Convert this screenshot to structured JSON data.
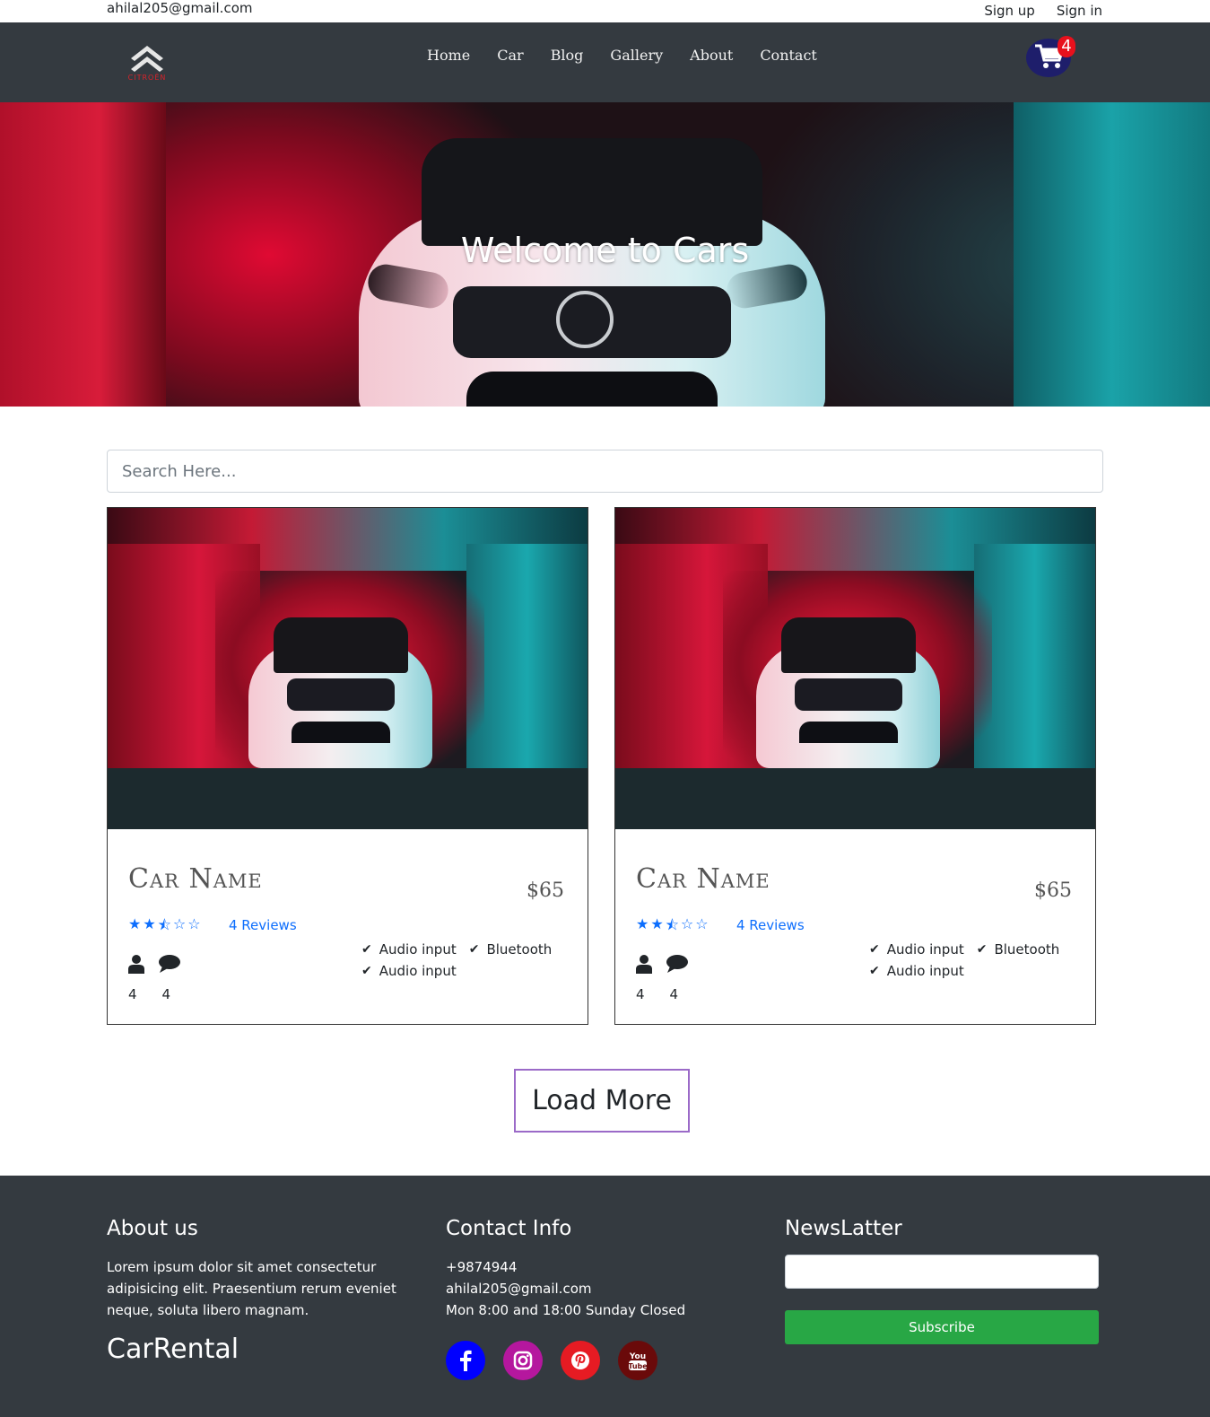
{
  "topbar": {
    "email": "ahilal205@gmail.com",
    "signup": "Sign up",
    "signin": "Sign in"
  },
  "brand": {
    "logo_text": "CITROËN"
  },
  "nav": {
    "items": [
      "Home",
      "Car",
      "Blog",
      "Gallery",
      "About",
      "Contact"
    ]
  },
  "cart": {
    "count": "4",
    "icon": "shopping-cart-icon"
  },
  "hero": {
    "title": "Welcome to Cars"
  },
  "search": {
    "placeholder": "Search Here..."
  },
  "cards": [
    {
      "name": "Car Name",
      "price": "$65",
      "rating": 2.5,
      "rating_max": 5,
      "reviews": "4 Reviews",
      "user_count": "4",
      "comment_count": "4",
      "features": [
        "Audio input",
        "Bluetooth",
        "Audio input"
      ]
    },
    {
      "name": "Car Name",
      "price": "$65",
      "rating": 2.5,
      "rating_max": 5,
      "reviews": "4 Reviews",
      "user_count": "4",
      "comment_count": "4",
      "features": [
        "Audio input",
        "Bluetooth",
        "Audio input"
      ]
    }
  ],
  "load_more": "Load More",
  "footer": {
    "about": {
      "heading": "About us",
      "text": "Lorem ipsum dolor sit amet consectetur adipisicing elit. Praesentium rerum eveniet neque, soluta libero magnam.",
      "brand": "CarRental"
    },
    "contact": {
      "heading": "Contact Info",
      "phone": "+9874944",
      "email": "ahilal205@gmail.com",
      "hours": "Mon 8:00 and 18:00 Sunday Closed",
      "social": [
        {
          "name": "facebook-icon",
          "color": "#0000ff",
          "glyph": "f"
        },
        {
          "name": "instagram-icon",
          "color": "#b5179e",
          "glyph": "◎"
        },
        {
          "name": "pinterest-icon",
          "color": "#e61b23",
          "glyph": "℗"
        },
        {
          "name": "youtube-icon",
          "color": "#6a0a0a",
          "glyph": "You Tube"
        }
      ]
    },
    "newsletter": {
      "heading": "NewsLatter",
      "button": "Subscribe"
    }
  },
  "colors": {
    "navbar": "#343a40",
    "accent": "#0d6efd",
    "subscribe": "#28a745",
    "load_more_border": "#9b6ac8"
  }
}
